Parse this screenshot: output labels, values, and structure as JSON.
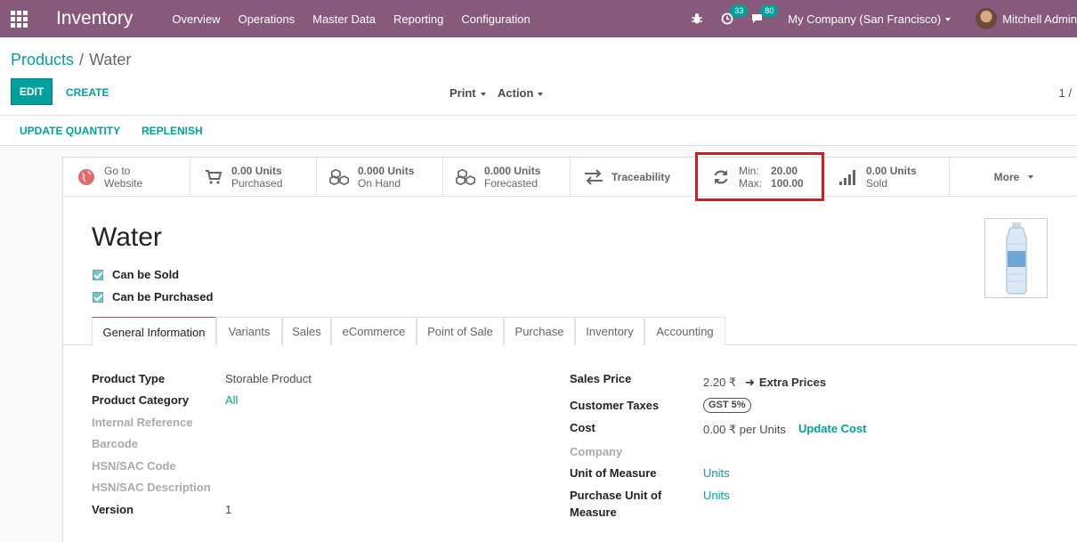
{
  "navbar": {
    "brand": "Inventory",
    "menu": [
      "Overview",
      "Operations",
      "Master Data",
      "Reporting",
      "Configuration"
    ],
    "activity_count": "33",
    "message_count": "80",
    "company": "My Company (San Francisco)",
    "user": "Mitchell Admin"
  },
  "breadcrumb": {
    "parent": "Products",
    "separator": "/",
    "current": "Water"
  },
  "control": {
    "edit": "EDIT",
    "create": "CREATE",
    "print": "Print",
    "action": "Action",
    "pager": "1 /"
  },
  "statusbar": {
    "update_quantity": "UPDATE QUANTITY",
    "replenish": "REPLENISH"
  },
  "stats": {
    "website": {
      "line1": "Go to",
      "line2": "Website"
    },
    "purchased": {
      "value": "0.00 Units",
      "label": "Purchased"
    },
    "onhand": {
      "value": "0.000 Units",
      "label": "On Hand"
    },
    "forecasted": {
      "value": "0.000 Units",
      "label": "Forecasted"
    },
    "traceability": {
      "label": "Traceability"
    },
    "reorder": {
      "min_label": "Min:",
      "min_value": "20.00",
      "max_label": "Max:",
      "max_value": "100.00"
    },
    "sold": {
      "value": "0.00 Units",
      "label": "Sold"
    },
    "more": "More"
  },
  "product": {
    "name": "Water",
    "can_be_sold": "Can be Sold",
    "can_be_purchased": "Can be Purchased"
  },
  "tabs": [
    "General Information",
    "Variants",
    "Sales",
    "eCommerce",
    "Point of Sale",
    "Purchase",
    "Inventory",
    "Accounting"
  ],
  "left_fields": {
    "product_type": {
      "label": "Product Type",
      "value": "Storable Product"
    },
    "product_category": {
      "label": "Product Category",
      "value": "All"
    },
    "internal_reference": {
      "label": "Internal Reference"
    },
    "barcode": {
      "label": "Barcode"
    },
    "hsn_code": {
      "label": "HSN/SAC Code"
    },
    "hsn_desc": {
      "label": "HSN/SAC Description"
    },
    "version": {
      "label": "Version",
      "value": "1"
    }
  },
  "right_fields": {
    "sales_price": {
      "label": "Sales Price",
      "value": "2.20 ₹",
      "extra": "Extra Prices"
    },
    "customer_taxes": {
      "label": "Customer Taxes",
      "tag": "GST 5%"
    },
    "cost": {
      "label": "Cost",
      "value": "0.00 ₹ per Units",
      "action": "Update Cost"
    },
    "company": {
      "label": "Company"
    },
    "uom": {
      "label": "Unit of Measure",
      "value": "Units"
    },
    "purchase_uom": {
      "label1": "Purchase Unit of",
      "label2": "Measure",
      "value": "Units"
    }
  },
  "colors": {
    "navbar": "#875a7b",
    "primary": "#00a09d",
    "highlight": "#e0161a"
  }
}
